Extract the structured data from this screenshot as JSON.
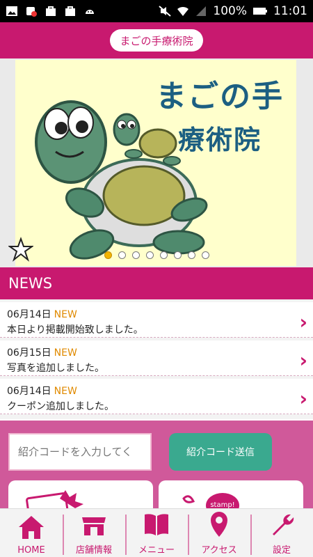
{
  "status_bar": {
    "battery": "100%",
    "time": "11:01",
    "icons": [
      "image-icon",
      "notification-icon",
      "bag-icon",
      "bag-icon",
      "android-icon",
      "mute-icon",
      "wifi-icon",
      "signal-icon",
      "battery-icon"
    ]
  },
  "header": {
    "title": "まごの手療術院"
  },
  "hero": {
    "logo_line1": "まごの手",
    "logo_line2": "療術院",
    "slide_count": 8,
    "active_slide": 1
  },
  "news": {
    "heading": "NEWS",
    "new_label": "NEW",
    "items": [
      {
        "date": "06月14日",
        "text": "本日より掲載開始致しました。"
      },
      {
        "date": "06月15日",
        "text": "写真を追加しました。"
      },
      {
        "date": "06月14日",
        "text": "クーポン追加しました。"
      }
    ]
  },
  "referral": {
    "placeholder": "紹介コードを入力してく",
    "button_label": "紹介コード送信"
  },
  "cards": {
    "stamp_label": "stamp!"
  },
  "tabs": [
    {
      "label": "HOME",
      "icon": "home-icon"
    },
    {
      "label": "店舗情報",
      "icon": "store-icon"
    },
    {
      "label": "メニュー",
      "icon": "book-icon"
    },
    {
      "label": "アクセス",
      "icon": "map-pin-icon"
    },
    {
      "label": "設定",
      "icon": "wrench-icon"
    }
  ],
  "colors": {
    "brand": "#c8196f",
    "accent_green": "#3aa98f",
    "new_badge": "#e08a00",
    "logo_text": "#1c5f82"
  }
}
